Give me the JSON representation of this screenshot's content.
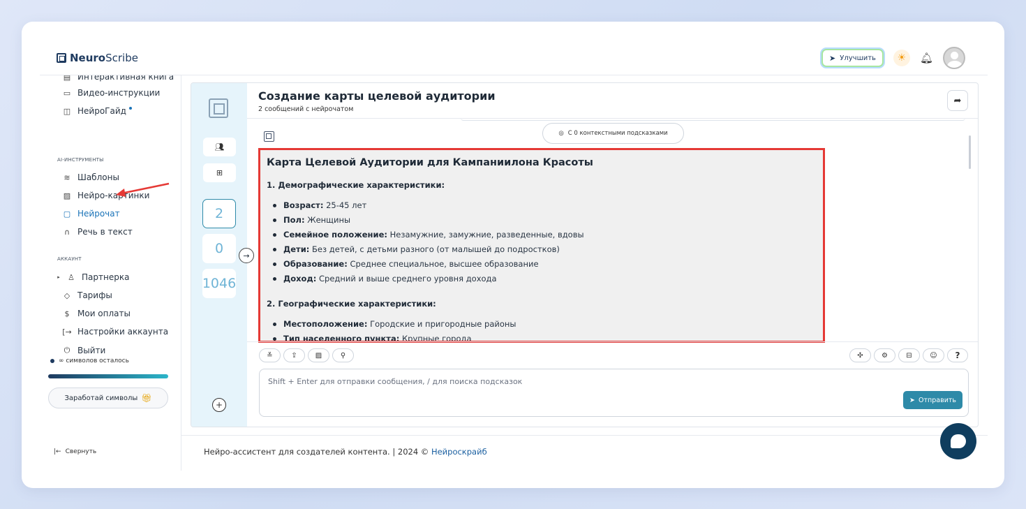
{
  "brand": {
    "part1": "Neuro",
    "part2": "Scribe"
  },
  "header": {
    "upgrade_label": "Улучшить"
  },
  "sidebar": {
    "top_items": [
      {
        "label": "Интерактивная книга",
        "icon": "book-icon"
      },
      {
        "label": "Видео-инструкции",
        "icon": "video-icon"
      },
      {
        "label": "НейроГайд",
        "icon": "guide-icon"
      }
    ],
    "ai_section_title": "AI-ИНСТРУМЕНТЫ",
    "ai_items": [
      {
        "label": "Шаблоны",
        "icon": "layers-icon"
      },
      {
        "label": "Нейро-картинки",
        "icon": "image-icon"
      },
      {
        "label": "Нейрочат",
        "icon": "chat-icon"
      },
      {
        "label": "Речь в текст",
        "icon": "headphones-icon"
      }
    ],
    "account_section_title": "АККАУНТ",
    "account_items": [
      {
        "label": "Партнерка",
        "icon": "users-icon"
      },
      {
        "label": "Тарифы",
        "icon": "tag-icon"
      },
      {
        "label": "Мои оплаты",
        "icon": "dollar-icon"
      },
      {
        "label": "Настройки аккаунта",
        "icon": "settings-arrow-icon"
      },
      {
        "label": "Выйти",
        "icon": "power-icon"
      }
    ],
    "symbols_text": "∞ символов осталось",
    "earn_label": "Заработай символы",
    "collapse_label": "Свернуть"
  },
  "rail": {
    "counters": [
      "2",
      "0",
      "1046"
    ]
  },
  "chat": {
    "title": "Создание карты целевой аудитории",
    "subtitle": "2 сообщений с нейрочатом",
    "context_label": "С 0 контекстными подсказками",
    "message": {
      "heading": "Карта Целевой Аудитории для Кампаниилона Красоты",
      "section1_title": "1. Демографические характеристики:",
      "section1_items": [
        {
          "key": "Возраст:",
          "value": " 25-45 лет"
        },
        {
          "key": "Пол:",
          "value": " Женщины"
        },
        {
          "key": "Семейное положение:",
          "value": " Незамужние, замужние, разведенные, вдовы"
        },
        {
          "key": "Дети:",
          "value": " Без детей, с детьми разного (от малышей до подростков)"
        },
        {
          "key": "Образование:",
          "value": " Среднее специальное, высшее образование"
        },
        {
          "key": "Доход:",
          "value": " Средний и выше среднего уровня дохода"
        }
      ],
      "section2_title": "2. Географические характеристики:",
      "section2_items": [
        {
          "key": "Местоположение:",
          "value": " Городские и пригородные районы"
        },
        {
          "key": "Тип населенного пункта:",
          "value": " Крупные города"
        }
      ]
    },
    "input_placeholder": "Shift + Enter для отправки сообщения, / для поиска подсказок",
    "send_label": "Отправить"
  },
  "footer": {
    "text": "Нейро-ассистент для создателей контента.  | 2024 © ",
    "link": "Нейроскрайб"
  },
  "colors": {
    "accent": "#2e8aa8",
    "highlight": "#e53935",
    "brand": "#1e3a5f"
  }
}
